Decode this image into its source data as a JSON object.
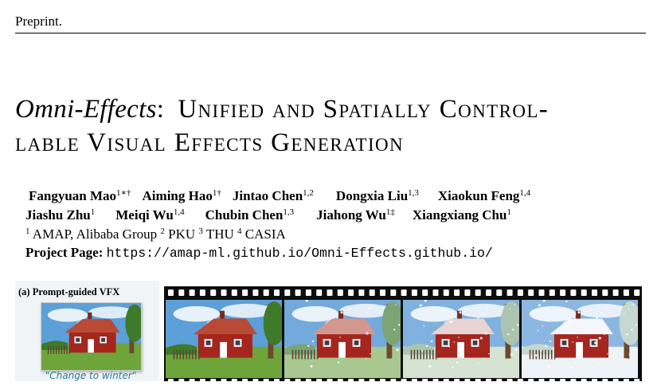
{
  "header": {
    "preprint": "Preprint."
  },
  "title": {
    "name": "Omni-Effects",
    "colon": ":",
    "line1_rest": "Unified and Spatially Control-",
    "line2": "lable Visual Effects Generation"
  },
  "authors": {
    "row1": [
      {
        "name": "Fangyuan Mao",
        "sup": "1∗†"
      },
      {
        "name": "Aiming Hao",
        "sup": "1†"
      },
      {
        "name": "Jintao Chen",
        "sup": "1,2"
      },
      {
        "name": "Dongxia Liu",
        "sup": "1,3"
      },
      {
        "name": "Xiaokun Feng",
        "sup": "1,4"
      }
    ],
    "row2": [
      {
        "name": "Jiashu Zhu",
        "sup": "1"
      },
      {
        "name": "Meiqi Wu",
        "sup": "1,4"
      },
      {
        "name": "Chubin Chen",
        "sup": "1,3"
      },
      {
        "name": "Jiahong Wu",
        "sup": "1‡"
      },
      {
        "name": "Xiangxiang Chu",
        "sup": "1"
      }
    ]
  },
  "affiliations": [
    {
      "sup": "1",
      "name": "AMAP, Alibaba Group"
    },
    {
      "sup": "2",
      "name": "PKU"
    },
    {
      "sup": "3",
      "name": "THU"
    },
    {
      "sup": "4",
      "name": "CASIA"
    }
  ],
  "project": {
    "label": "Project Page:",
    "url": "https://amap-ml.github.io/Omni-Effects.github.io/"
  },
  "figure": {
    "panel_label": "(a) Prompt-guided VFX",
    "prompt_caption": "\"Change to winter\"",
    "frames": [
      {
        "season": "summer",
        "snow": 0.0
      },
      {
        "season": "early-winter",
        "snow": 0.45
      },
      {
        "season": "winter",
        "snow": 0.8
      },
      {
        "season": "deep-winter",
        "snow": 1.0
      }
    ],
    "colors": {
      "house": "#a4261f",
      "roof": "#b94a36",
      "sky": "#5d9fd8",
      "grass": "#6ea53a",
      "film": "#0d0d0d"
    }
  }
}
